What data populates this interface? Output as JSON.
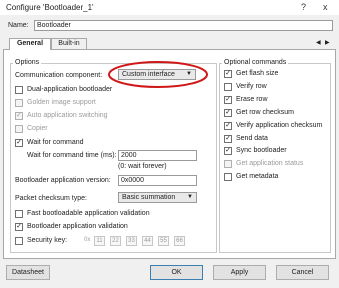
{
  "window": {
    "title": "Configure 'Bootloader_1'",
    "help_icon": "?",
    "close_icon": "x"
  },
  "name_row": {
    "label": "Name:",
    "value": "Bootloader"
  },
  "tabs": [
    {
      "label": "General"
    },
    {
      "label": "Built-in"
    }
  ],
  "tab_nav": {
    "left": "◀",
    "right": "▶"
  },
  "options": {
    "title": "Options",
    "communication_label": "Communication component:",
    "communication_value": "Custom interface",
    "dual_app": "Dual-application bootloader",
    "golden_image": "Golden image support",
    "auto_switching": "Auto application switching",
    "copier": "Copier",
    "wait_for_command": "Wait for command",
    "wait_time_label": "Wait for command time (ms):",
    "wait_time_value": "2000",
    "wait_time_hint": "(0: wait forever)",
    "app_version_label": "Bootloader application version:",
    "app_version_value": "0x0000",
    "checksum_label": "Packet checksum type:",
    "checksum_value": "Basic summation",
    "fast_validation": "Fast bootloadable application validation",
    "app_validation": "Bootloader application validation",
    "security_key": "Security key:",
    "key_bytes": [
      "0x",
      "11",
      "22",
      "33",
      "44",
      "55",
      "66"
    ]
  },
  "optional": {
    "title": "Optional commands",
    "items": [
      {
        "label": "Get flash size",
        "checked": true
      },
      {
        "label": "Verify row",
        "checked": false
      },
      {
        "label": "Erase row",
        "checked": true
      },
      {
        "label": "Get row checksum",
        "checked": true
      },
      {
        "label": "Verify application checksum",
        "checked": true
      },
      {
        "label": "Send data",
        "checked": true
      },
      {
        "label": "Sync bootloader",
        "checked": true
      },
      {
        "label": "Get application status",
        "checked": false,
        "disabled": true
      },
      {
        "label": "Get metadata",
        "checked": false
      }
    ]
  },
  "buttons": {
    "datasheet": "Datasheet",
    "ok": "OK",
    "apply": "Apply",
    "cancel": "Cancel"
  },
  "colors": {
    "annotation": "#d01818",
    "accent": "#3c7fb1"
  }
}
